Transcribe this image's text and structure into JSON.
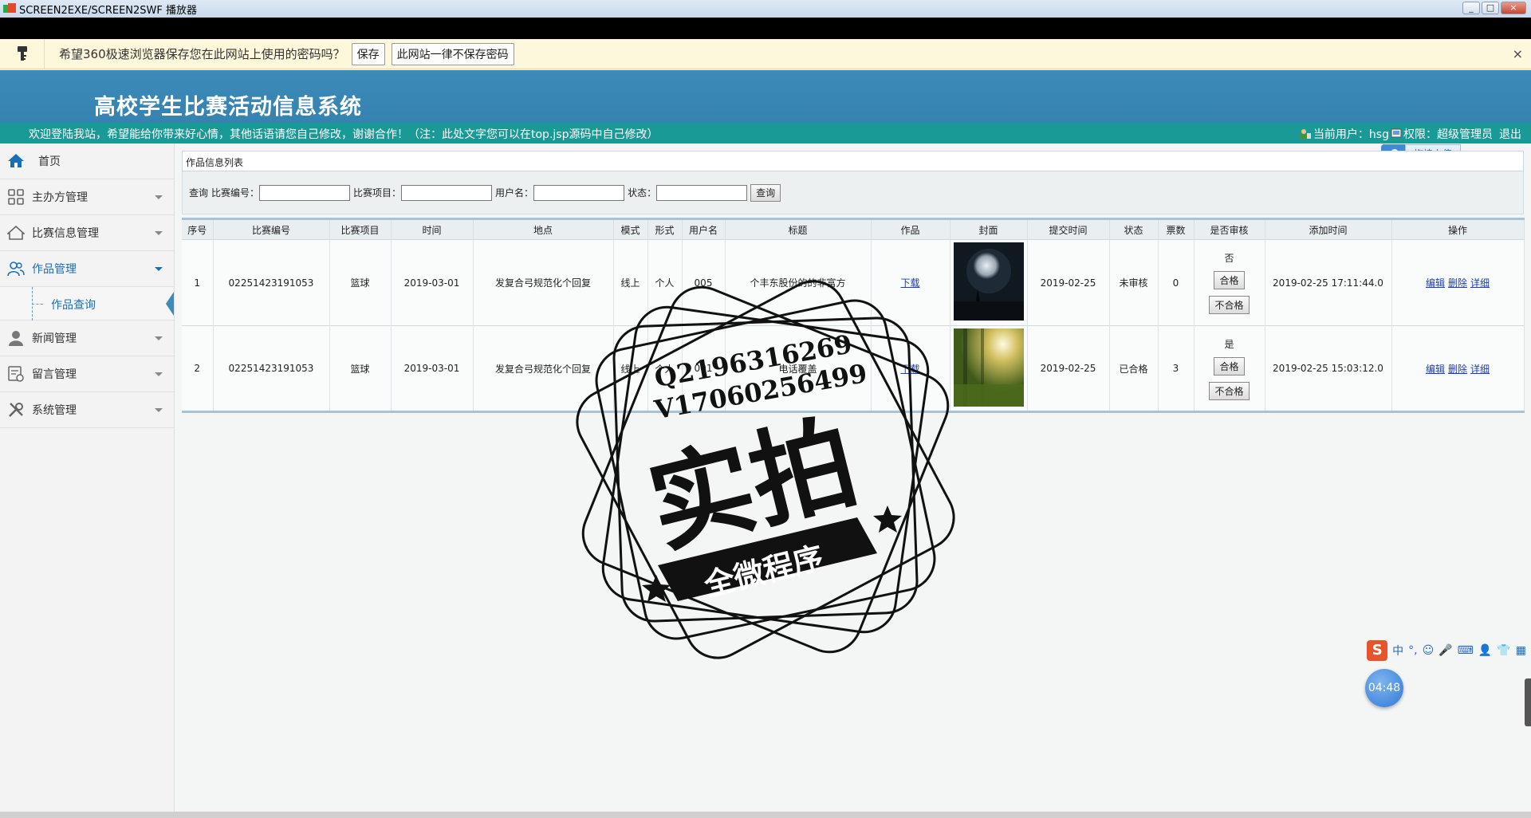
{
  "window": {
    "title": "SCREEN2EXE/SCREEN2SWF 播放器",
    "min": "_",
    "max": "□",
    "close": "×"
  },
  "password_bar": {
    "message": "希望360极速浏览器保存您在此网站上使用的密码吗？",
    "save_label": "保存",
    "never_label": "此网站一律不保存密码",
    "close": "×"
  },
  "header": {
    "title": "高校学生比赛活动信息系统"
  },
  "subbar": {
    "welcome": "欢迎登陆我站，希望能给你带来好心情，其他话语请您自己修改，谢谢合作！（注：此处文字您可以在top.jsp源码中自己修改）",
    "current_user": "当前用户：hsg",
    "role": "权限：超级管理员",
    "logout": "退出"
  },
  "upload_badge": {
    "label": "拖拽上传"
  },
  "sidebar": {
    "items": [
      {
        "label": "首页",
        "icon": "home-icon"
      },
      {
        "label": "主办方管理",
        "icon": "grid-icon"
      },
      {
        "label": "比赛信息管理",
        "icon": "house-icon"
      },
      {
        "label": "作品管理",
        "icon": "users-icon"
      },
      {
        "label": "新闻管理",
        "icon": "person-icon"
      },
      {
        "label": "留言管理",
        "icon": "message-icon"
      },
      {
        "label": "系统管理",
        "icon": "tools-icon"
      }
    ],
    "sub_item": "作品查询"
  },
  "panel": {
    "title": "作品信息列表"
  },
  "search": {
    "prefix": "查询",
    "f1": "比赛编号：",
    "f2": "比赛项目：",
    "f3": "用户名：",
    "f4": "状态：",
    "button": "查询"
  },
  "table": {
    "headers": [
      "序号",
      "比赛编号",
      "比赛项目",
      "时间",
      "地点",
      "模式",
      "形式",
      "用户名",
      "标题",
      "作品",
      "封面",
      "提交时间",
      "状态",
      "票数",
      "是否审核",
      "添加时间",
      "操作"
    ],
    "rows": [
      {
        "no": "1",
        "code": "02251423191053",
        "project": "篮球",
        "time": "2019-03-01",
        "place": "发复合弓规范化个回复",
        "mode": "线上",
        "form": "个人",
        "user": "005",
        "title": "个丰东股份的的非富方",
        "work": "下载",
        "submit": "2019-02-25",
        "status": "未审核",
        "votes": "0",
        "verified": "否",
        "pass": "合格",
        "fail": "不合格",
        "added": "2019-02-25 17:11:44.0",
        "edit": "编辑",
        "del": "删除",
        "detail": "详细"
      },
      {
        "no": "2",
        "code": "02251423191053",
        "project": "篮球",
        "time": "2019-03-01",
        "place": "发复合弓规范化个回复",
        "mode": "线上",
        "form": "个人",
        "user": "001",
        "title": "电话覆盖",
        "work": "下载",
        "submit": "2019-02-25",
        "status": "已合格",
        "votes": "3",
        "verified": "是",
        "pass": "合格",
        "fail": "不合格",
        "added": "2019-02-25 15:03:12.0",
        "edit": "编辑",
        "del": "删除",
        "detail": "详细"
      }
    ]
  },
  "watermark": {
    "line1": "Q2196316269",
    "line2": "V17060256499",
    "big": "实拍",
    "ribbon": "全微程序"
  },
  "ime": {
    "logo": "S",
    "mode": "中"
  },
  "timer": "04:48",
  "colors": {
    "header": "#3c8bb9",
    "subbar": "#1a9a96",
    "link": "#1d3db5",
    "accent": "#1a6fb8"
  }
}
